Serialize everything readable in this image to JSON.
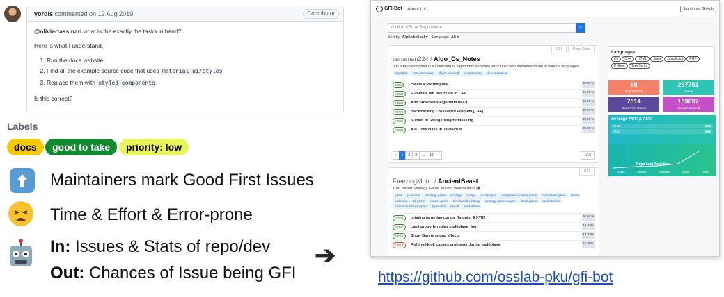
{
  "comment": {
    "author": "yordis",
    "meta": "commented on 19 Aug 2019",
    "badge": "Contributor",
    "mention": "@oliviertassinari",
    "line1_rest": " what is the exactly the tasks in hand?",
    "line2": "Here is what I understand,",
    "steps": [
      {
        "text": "Run the docs website",
        "code": ""
      },
      {
        "text": "Find all the example source code that uses ",
        "code": "material-ui/styles"
      },
      {
        "text": "Replace them with ",
        "code": "styled-components"
      }
    ],
    "closing": "Is this correct?"
  },
  "labels": {
    "title": "Labels",
    "items": [
      {
        "text": "docs",
        "bg": "#f3c900",
        "fg": "#000000"
      },
      {
        "text": "good to take",
        "bg": "#0f8a2d",
        "fg": "#ffffff"
      },
      {
        "text": "priority: low",
        "bg": "#e8f55a",
        "fg": "#000000"
      }
    ]
  },
  "bullets": [
    {
      "icon": "up-arrow-icon",
      "text": "Maintainers mark Good First Issues"
    },
    {
      "icon": "tired-face-icon",
      "text": "Time & Effort & Error-prone"
    },
    {
      "icon": "robot-icon",
      "bold": "In:",
      "text": " Issues & Stats of repo/dev"
    },
    {
      "bold": "Out:",
      "text": " Chances of Issue being GFI"
    }
  ],
  "url": "https://github.com/osslab-pku/gfi-bot",
  "gfibot": {
    "brand": "GFI-Bot",
    "about": "About Us",
    "signin": "Sign in via GitHub",
    "search_placeholder": "GitHub URL or Repo Name",
    "sort_label": "Sort by",
    "sort_value": "Alphabetical ▾",
    "lang_label": "Language",
    "lang_value": "All ▾",
    "tab_gfi": "GFI",
    "tab_repo": "Repo Data",
    "repo1": {
      "owner": "jainaman224",
      "sep": " / ",
      "name": "Algo_Ds_Notes",
      "desc": "It is a repository that is a collection of algorithms and data structures with implementation in various languages.",
      "tags": [
        "algorithm",
        "data-structures",
        "object-oriented",
        "programming",
        "documentation"
      ],
      "issues": [
        {
          "num": "#657",
          "title": "create a PR template",
          "prob": "99.99 %"
        },
        {
          "num": "#1638",
          "title": "Eliminate left recursion in C++",
          "prob": "99.99 %"
        },
        {
          "num": "#1698",
          "title": "Add Strassen's algorithm in C#",
          "prob": "99.99 %"
        },
        {
          "num": "#1776",
          "title": "Backtracking Crossword Problem [C++]",
          "prob": "99.99 %"
        },
        {
          "num": "#1596",
          "title": "Subset of String using Bitmasking",
          "prob": "99.99 %"
        },
        {
          "num": "#1623",
          "title": "AVL Tree class in Javascript",
          "prob": "99.99 %"
        }
      ],
      "pages": [
        "‹",
        "1",
        "2",
        "3",
        "...",
        "16",
        "›"
      ],
      "page_box": "1/16"
    },
    "repo2": {
      "owner": "FreezingMoon",
      "sep": " / ",
      "name": "AncientBeast",
      "desc": "Turn Based Strategy Game. Master your beasts! 🐗",
      "tags": [
        "game",
        "javascript",
        "strategy-game",
        "strategy",
        "nodejs",
        "multiplayer",
        "multiplayer-browser-game",
        "multiplayer-game",
        "chess",
        "pokemon",
        "2d-game",
        "phaser-game",
        "turn-based-strategy",
        "strategy-game-engine",
        "html5-game",
        "hacktoberfest",
        "hacktoberfest-accepted",
        "typescript",
        "esport",
        "spritesheet"
      ],
      "issues": [
        {
          "num": "#2003",
          "title": "rotating targeting cursor [bounty: 9 XTR]",
          "prob": "26.66 %",
          "red": false
        },
        {
          "num": "#1750",
          "title": "can't properly replay multiplayer log",
          "prob": "16.62%",
          "red": false
        },
        {
          "num": "#1065",
          "title": "Snow Bunny sound effects",
          "prob": "13.92%",
          "red": false
        },
        {
          "num": "#1614",
          "title": "Fishing Hook causes problems during multiplayer",
          "prob": "11.55%",
          "red": true
        }
      ]
    },
    "side": {
      "lang_title": "Languages",
      "langs": [
        "C#",
        "C++",
        "HTML",
        "Java",
        "JavaScript",
        "PHP",
        "Python",
        "TypeScript"
      ],
      "tiles": [
        {
          "value": "98",
          "label": "Repositories",
          "color": "#f4826a"
        },
        {
          "value": "297751",
          "label": "Issues",
          "color": "#2ec4b6"
        },
        {
          "value": "7514",
          "label": "Good First Issues",
          "color": "#5b4a9b"
        },
        {
          "value": "159697",
          "label": "Issues Resolved",
          "color": "#c44fc9"
        }
      ],
      "auc_title": "Average AUC & ACC",
      "auc_label": "AUC",
      "auc_value": "0.96",
      "acc_label": "ACC",
      "acc_value": "0.94",
      "activity_title": "Repo Last Activities",
      "activity_x": [
        "7Days",
        "1Month",
        "3Months",
        "1Year",
        "Older"
      ]
    }
  }
}
